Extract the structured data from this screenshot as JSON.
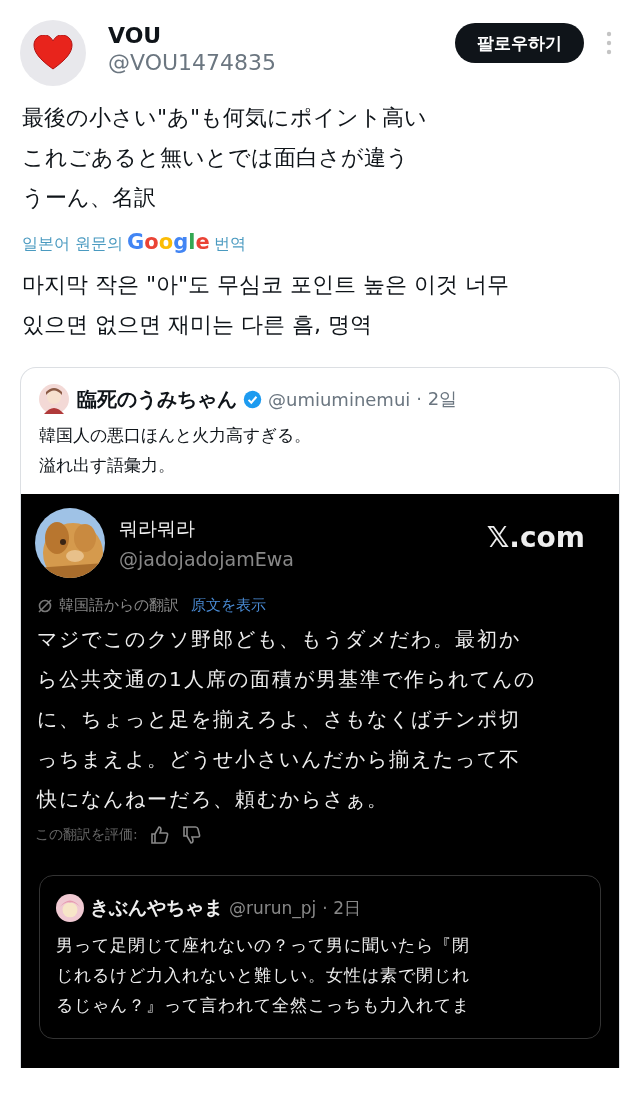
{
  "post": {
    "name": "VOU",
    "handle": "@VOU1474835",
    "follow_button": "팔로우하기",
    "text_lines": [
      "最後の小さい\"あ\"も何気にポイント高い",
      "これごあると無いとでは面白さが違う",
      "うーん、名訳"
    ],
    "translation_note": {
      "before": "일본어 원문의",
      "brand": "Google",
      "after": "번역"
    },
    "translated_lines": [
      "마지막 작은 \"아\"도 무심코 포인트 높은 이것 너무",
      "있으면 없으면 재미는 다른 흠, 명역"
    ]
  },
  "quote": {
    "name": "臨死のうみちゃん",
    "verified": true,
    "handle": "@umiuminemui",
    "time": "· 2일",
    "text_lines": [
      "韓国人の悪口ほんと火力高すぎる。",
      "溢れ出す語彙力。"
    ],
    "image": {
      "name": "뭐라뭐라",
      "handle": "@jadojadojamEwa",
      "site": "𝕏.com",
      "translation_label": "韓国語からの翻訳",
      "show_original": "原文を表示",
      "text_lines": [
        "マジでこのクソ野郎ども、もうダメだわ。最初か",
        "ら公共交通の1人席の面積が男基準で作られてんの",
        "に、ちょっと足を揃えろよ、さもなくばチンポ切",
        "っちまえよ。どうせ小さいんだから揃えたって不",
        "快になんねーだろ、頼むからさぁ。"
      ],
      "rate_label": "この翻訳を評価:",
      "nested": {
        "name": "きぶんやちゃま",
        "handle": "@rurun_pj",
        "time": "· 2日",
        "text_lines": [
          "男って足閉じて座れないの？って男に聞いたら『閉",
          "じれるけど力入れないと難しい。女性は素で閉じれ",
          "るじゃん？』って言われて全然こっちも力入れてま"
        ]
      }
    }
  }
}
